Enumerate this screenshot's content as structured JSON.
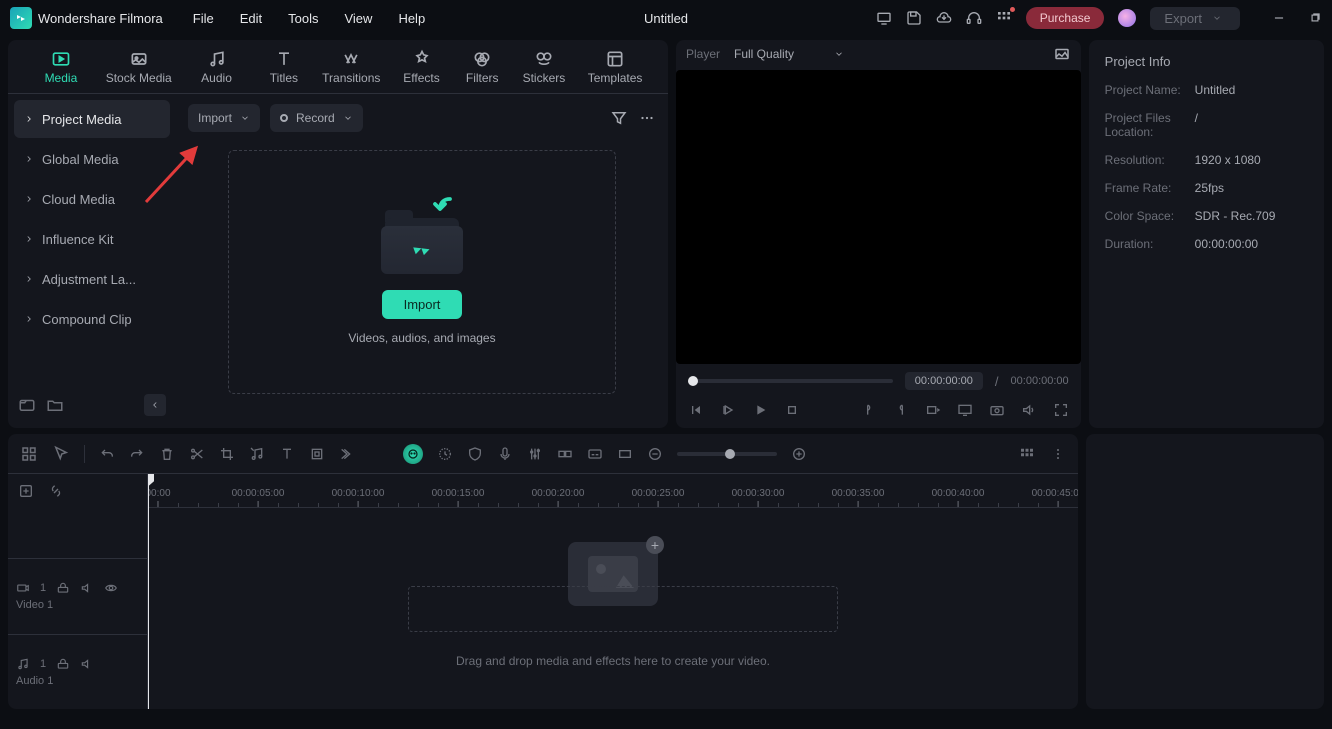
{
  "app_name": "Wondershare Filmora",
  "menu": {
    "file": "File",
    "edit": "Edit",
    "tools": "Tools",
    "view": "View",
    "help": "Help"
  },
  "doc_title": "Untitled",
  "titlebar": {
    "purchase": "Purchase",
    "export": "Export"
  },
  "cat_tabs": {
    "media": "Media",
    "stock": "Stock Media",
    "audio": "Audio",
    "titles": "Titles",
    "transitions": "Transitions",
    "effects": "Effects",
    "filters": "Filters",
    "stickers": "Stickers",
    "templates": "Templates"
  },
  "sidebar": {
    "items": [
      {
        "label": "Project Media"
      },
      {
        "label": "Global Media"
      },
      {
        "label": "Cloud Media"
      },
      {
        "label": "Influence Kit"
      },
      {
        "label": "Adjustment La..."
      },
      {
        "label": "Compound Clip"
      }
    ]
  },
  "media_toolbar": {
    "import": "Import",
    "record": "Record"
  },
  "dropzone": {
    "import_btn": "Import",
    "hint": "Videos, audios, and images"
  },
  "player": {
    "label": "Player",
    "quality": "Full Quality",
    "tc_current": "00:00:00:00",
    "tc_sep": "/",
    "tc_total": "00:00:00:00"
  },
  "project_info": {
    "title": "Project Info",
    "rows": [
      {
        "k": "Project Name:",
        "v": "Untitled"
      },
      {
        "k": "Project Files Location:",
        "v": "/"
      },
      {
        "k": "Resolution:",
        "v": "1920 x 1080"
      },
      {
        "k": "Frame Rate:",
        "v": "25fps"
      },
      {
        "k": "Color Space:",
        "v": "SDR - Rec.709"
      },
      {
        "k": "Duration:",
        "v": "00:00:00:00"
      }
    ]
  },
  "timeline": {
    "ruler": [
      "00:00",
      "00:00:05:00",
      "00:00:10:00",
      "00:00:15:00",
      "00:00:20:00",
      "00:00:25:00",
      "00:00:30:00",
      "00:00:35:00",
      "00:00:40:00",
      "00:00:45:00"
    ],
    "tracks": {
      "video": "Video 1",
      "audio": "Audio 1"
    },
    "hint": "Drag and drop media and effects here to create your video."
  }
}
